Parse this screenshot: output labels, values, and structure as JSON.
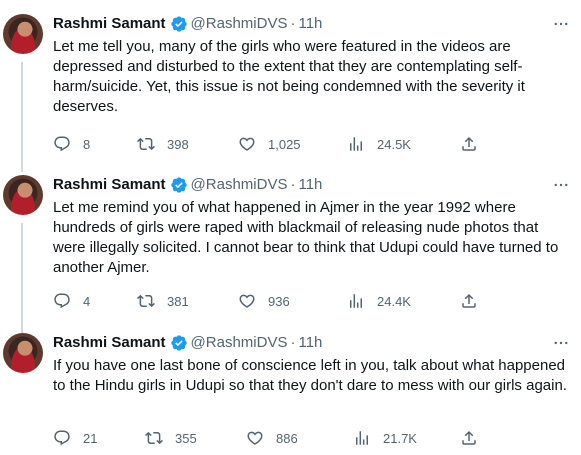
{
  "tweets": [
    {
      "name": "Rashmi Samant",
      "handle": "@RashmiDVS",
      "separator": "·",
      "time": "11h",
      "text": "Let me tell you, many of the girls who were featured in the videos are depressed and disturbed to the extent that they are contemplating self-harm/suicide. Yet, this issue is not being condemned with the severity it deserves.",
      "replies": "8",
      "retweets": "398",
      "likes": "1,025",
      "views": "24.5K"
    },
    {
      "name": "Rashmi Samant",
      "handle": "@RashmiDVS",
      "separator": "·",
      "time": "11h",
      "text": "Let me remind you of what happened in Ajmer in the year 1992 where hundreds of girls were raped with blackmail of releasing nude photos that were illegally solicited. I cannot bear to think that Udupi could have turned to another Ajmer.",
      "replies": "4",
      "retweets": "381",
      "likes": "936",
      "views": "24.4K"
    },
    {
      "name": "Rashmi Samant",
      "handle": "@RashmiDVS",
      "separator": "·",
      "time": "11h",
      "text": "If you have one last bone of conscience left in you, talk about what happened to the Hindu girls in Udupi so that they don't dare to mess with our girls again.",
      "replies": "21",
      "retweets": "355",
      "likes": "886",
      "views": "21.7K"
    }
  ],
  "colors": {
    "verified": "#1d9bf0",
    "muted": "#536471",
    "text": "#0f1419",
    "threadLine": "#cfd9de"
  },
  "icons": [
    "verified-badge-icon",
    "more-icon",
    "reply-icon",
    "retweet-icon",
    "like-icon",
    "views-icon",
    "share-icon"
  ]
}
